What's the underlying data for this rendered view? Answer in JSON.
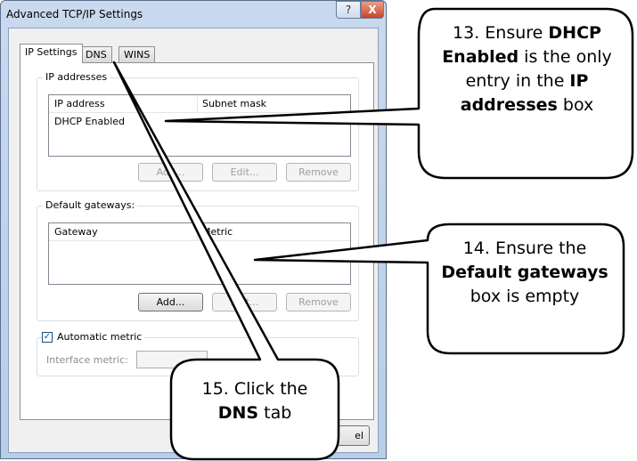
{
  "window": {
    "title": "Advanced TCP/IP Settings",
    "help_button": "?",
    "close_button": "X"
  },
  "tabs": [
    {
      "label": "IP Settings",
      "active": true
    },
    {
      "label": "DNS",
      "active": false
    },
    {
      "label": "WINS",
      "active": false
    }
  ],
  "ip_addresses": {
    "group_label": "IP addresses",
    "columns": [
      "IP address",
      "Subnet mask"
    ],
    "rows": [
      [
        "DHCP Enabled",
        ""
      ]
    ],
    "buttons": {
      "add": "Add...",
      "edit": "Edit...",
      "remove": "Remove"
    }
  },
  "default_gateways": {
    "group_label": "Default gateways:",
    "columns": [
      "Gateway",
      "Metric"
    ],
    "rows": [],
    "buttons": {
      "add": "Add...",
      "edit": "Edit...",
      "remove": "Remove"
    }
  },
  "automatic_metric": {
    "label": "Automatic metric",
    "checked": true,
    "interface_metric_label": "Interface metric:",
    "interface_metric_value": ""
  },
  "footer": {
    "cancel_partial": "el"
  },
  "callouts": {
    "step13": {
      "prefix": "13. Ensure ",
      "bold1": "DHCP Enabled",
      "mid": " is the only entry in the ",
      "bold2": "IP addresses",
      "suffix": " box"
    },
    "step14": {
      "prefix": "14. Ensure the ",
      "bold1": "Default gateways",
      "suffix": " box is empty"
    },
    "step15": {
      "prefix": "15. Click the ",
      "bold1": "DNS",
      "suffix": " tab"
    }
  },
  "colors": {
    "title_bar": "#c9d9ee",
    "close_button": "#c7432c",
    "check_mark": "#1c5180"
  }
}
